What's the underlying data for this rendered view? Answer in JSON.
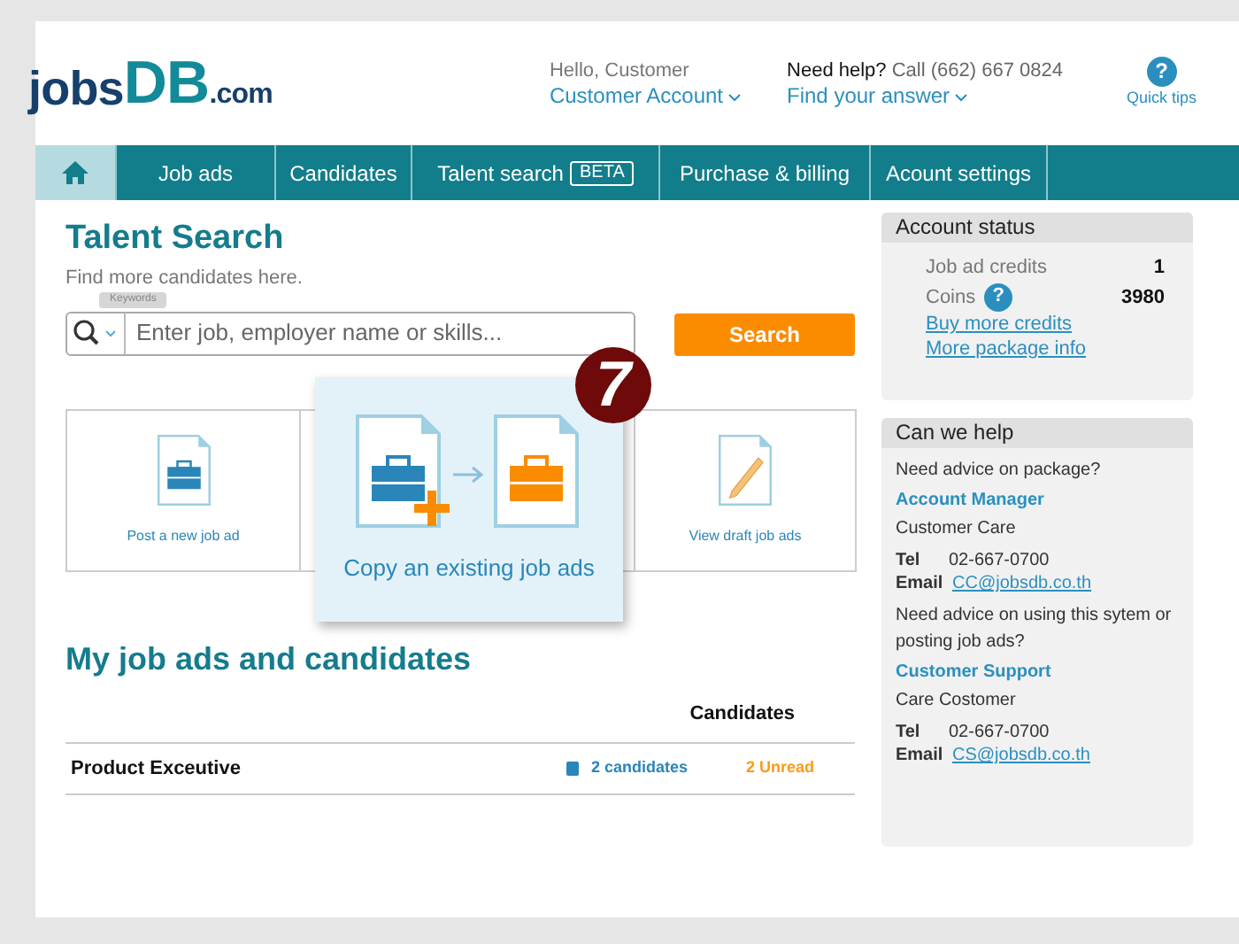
{
  "header": {
    "logo": {
      "first": "jobs",
      "second": "DB",
      "third": ".com"
    },
    "greeting": "Hello, Customer",
    "account_menu": "Customer Account",
    "help": "**Need help?** Call (662) 667 0824",
    "find_answer": "Find your answer",
    "quick_tips": {
      "glyph": "?",
      "label": "Quick tips"
    }
  },
  "nav": [
    {
      "kind": "home",
      "selected": true
    },
    {
      "kind": "link",
      "label": "Job ads",
      "selected": false
    },
    {
      "kind": "link",
      "label": "Candidates",
      "selected": false
    },
    {
      "kind": "link",
      "label": "Talent search",
      "badge": "BETA",
      "selected": false
    },
    {
      "kind": "link",
      "label": "Purchase & billing",
      "selected": false
    },
    {
      "kind": "link",
      "label": "Acount settings",
      "selected": false
    }
  ],
  "talent_search": {
    "title": "Talent Search",
    "subtitle": "Find more candidates here.",
    "field_label": "Keywords",
    "placeholder": "Enter job, employer name or skills...",
    "button": "Search"
  },
  "actions": [
    {
      "label": "Post a new job ad",
      "kind": "post"
    },
    {
      "label": "Copy an existing job ads",
      "kind": "copy",
      "badge": "7"
    },
    {
      "label": "View draft job ads",
      "kind": "draft"
    }
  ],
  "my_ads": {
    "title": "My job ads and candidates",
    "columns": [
      "Candidates"
    ],
    "rows": [
      {
        "title": "Product Exceutive",
        "candidates": "2 candidates",
        "unread": "2 Unread"
      }
    ]
  },
  "account_status": {
    "title": "Account status",
    "rows": [
      {
        "label": "Job ad credits",
        "value": "1"
      },
      {
        "label": "Coins",
        "help": "?",
        "value": "3980"
      }
    ],
    "links": [
      "Buy more credits",
      "More package info"
    ]
  },
  "help_box": {
    "title": "Can we help",
    "sections": [
      {
        "question": "Need advice on package?",
        "contact": "Account Manager",
        "team": "Customer Care",
        "tel_label": "Tel",
        "tel": "02-667-0700",
        "email_label": "Email",
        "email": "CC@jobsdb.co.th"
      },
      {
        "question": "Need advice on using this sytem or posting job ads?",
        "contact": "Customer Support",
        "team": "Care Costomer",
        "tel_label": "Tel",
        "tel": "02-667-0700",
        "email_label": "Email",
        "email": "CS@jobsdb.co.th"
      }
    ]
  }
}
